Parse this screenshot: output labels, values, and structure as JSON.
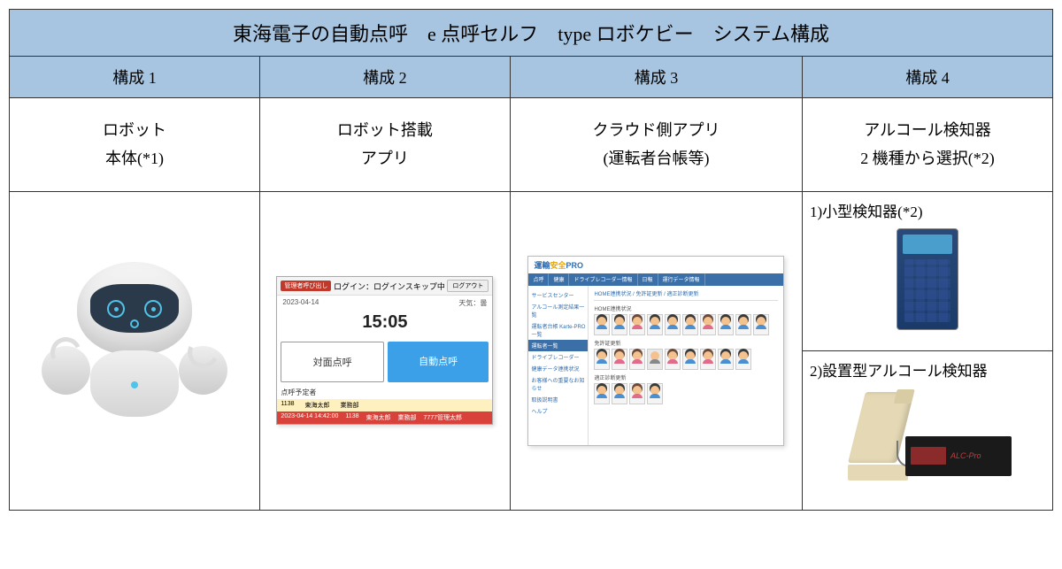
{
  "title": "東海電子の自動点呼　e 点呼セルフ　type ロボケビー　システム構成",
  "headers": [
    "構成 1",
    "構成 2",
    "構成 3",
    "構成 4"
  ],
  "descriptions": [
    {
      "line1": "ロボット",
      "line2": "本体(*1)"
    },
    {
      "line1": "ロボット搭載",
      "line2": "アプリ"
    },
    {
      "line1": "クラウド側アプリ",
      "line2": "(運転者台帳等)"
    },
    {
      "line1": "アルコール検知器",
      "line2": "2 機種から選択(*2)"
    }
  ],
  "app": {
    "badge": "管理者呼び出し",
    "login": "ログイン：ログインスキップ中",
    "logout": "ログアウト",
    "date": "2023-04-14",
    "time": "15:05",
    "weather": "天気：曇",
    "btn_face": "対面点呼",
    "btn_auto": "自動点呼",
    "sched_label": "点呼予定者",
    "sched1_time": "1138",
    "sched1_name": "東海太郎",
    "sched1_dept": "業務部",
    "sched2_datetime": "2023-04-14 14:42:00",
    "sched2_time": "1138",
    "sched2_name": "東海太郎",
    "sched2_dept": "業務部",
    "sched2_mgr": "7777管理太郎"
  },
  "cloud": {
    "logo_a": "運輸",
    "logo_b": "安全",
    "logo_c": "PRO",
    "nav": [
      "点呼",
      "健康",
      "ドライブレコーダー情報",
      "日報",
      "運行データ情報"
    ],
    "side": [
      "サービスセンター",
      "アルコール測定結果一覧",
      "運転者台帳 Karte-PRO一覧",
      "運転者一覧",
      "ドライブレコーダー",
      "健康データ連携状況",
      "お客様への重要なお知らせ",
      "取扱説明書",
      "ヘルプ"
    ],
    "side_active_index": 3,
    "breadcrumb": "HOME連携状況 / 免許証更新 / 適正診断更新",
    "section1": "HOME連携状況",
    "section2": "免許証更新",
    "section3": "適正診断更新"
  },
  "detectors": {
    "opt1": "1)小型検知器(*2)",
    "opt2": "2)設置型アルコール検知器",
    "display_brand": "ALC-Pro"
  }
}
